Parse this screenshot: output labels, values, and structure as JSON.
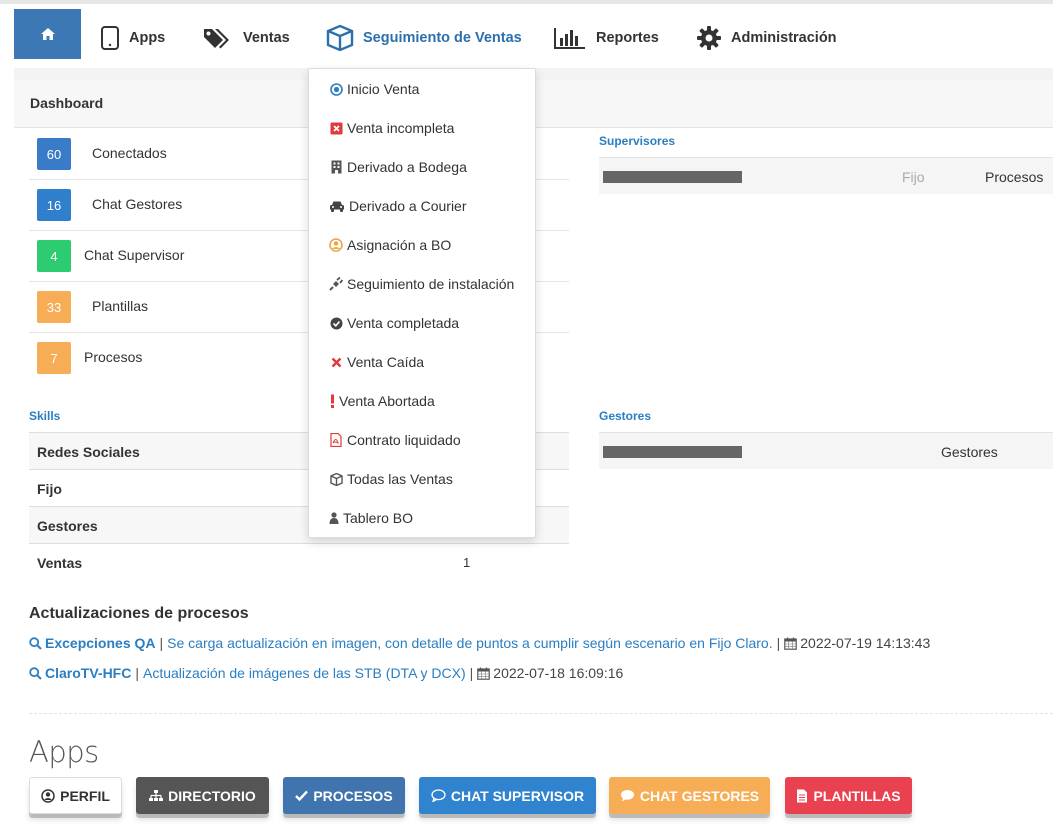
{
  "nav": {
    "items": [
      {
        "label": "Apps",
        "icon": "tablet-icon"
      },
      {
        "label": "Ventas",
        "icon": "tags-icon"
      },
      {
        "label": "Seguimiento de Ventas",
        "icon": "cube-icon"
      },
      {
        "label": "Reportes",
        "icon": "bar-chart-icon"
      },
      {
        "label": "Administración",
        "icon": "gear-icon"
      }
    ],
    "accent": "#3c78b4"
  },
  "dashboard": {
    "title": "Dashboard",
    "counters": [
      {
        "value": "60",
        "label": "Conectados",
        "color": "#3a7bc8"
      },
      {
        "value": "16",
        "label": "Chat Gestores",
        "color": "#2f7fcd"
      },
      {
        "value": "4",
        "label": "Chat Supervisor",
        "color": "#2ecc71"
      },
      {
        "value": "33",
        "label": "Plantillas",
        "color": "#f6ad55"
      },
      {
        "value": "7",
        "label": "Procesos",
        "color": "#f6ad55"
      }
    ],
    "skills_label": "Skills",
    "skills": [
      {
        "name": "Redes Sociales",
        "value": ""
      },
      {
        "name": "Fijo",
        "value": ""
      },
      {
        "name": "Gestores",
        "value": ""
      },
      {
        "name": "Ventas",
        "value": "1"
      }
    ],
    "supervisores": {
      "label": "Supervisores",
      "row": {
        "fijo": "Fijo",
        "procesos": "Procesos"
      }
    },
    "gestores": {
      "label": "Gestores",
      "row": {
        "gestores": "Gestores"
      }
    }
  },
  "dropdown": {
    "items": [
      {
        "label": "Inicio Venta",
        "icon": "target-icon"
      },
      {
        "label": "Venta incompleta",
        "icon": "x-square-icon"
      },
      {
        "label": "Derivado a Bodega",
        "icon": "building-icon"
      },
      {
        "label": "Derivado a Courier",
        "icon": "car-icon"
      },
      {
        "label": "Asignación a BO",
        "icon": "user-circle-icon"
      },
      {
        "label": "Seguimiento de instalación",
        "icon": "plug-icon"
      },
      {
        "label": "Venta completada",
        "icon": "check-circle-icon"
      },
      {
        "label": "Venta Caída",
        "icon": "x-icon"
      },
      {
        "label": "Venta Abortada",
        "icon": "exclamation-icon"
      },
      {
        "label": "Contrato liquidado",
        "icon": "pdf-icon"
      },
      {
        "label": "Todas las Ventas",
        "icon": "cube-icon"
      },
      {
        "label": "Tablero BO",
        "icon": "user-icon"
      }
    ]
  },
  "updates": {
    "title": "Actualizaciones de procesos",
    "items": [
      {
        "name": "Excepciones QA",
        "desc": "Se carga actualización en imagen, con detalle de puntos a cumplir según escenario en Fijo Claro.",
        "date": "2022-07-19 14:13:43"
      },
      {
        "name": "ClaroTV-HFC",
        "desc": "Actualización de imágenes de las STB (DTA y DCX)",
        "date": "2022-07-18 16:09:16"
      }
    ]
  },
  "apps": {
    "heading": "Apps",
    "buttons": [
      {
        "label": "PERFIL",
        "color": "#ffffff",
        "icon": "user-circle-icon"
      },
      {
        "label": "DIRECTORIO",
        "color": "#555555",
        "icon": "sitemap-icon"
      },
      {
        "label": "PROCESOS",
        "color": "#3f74ae",
        "icon": "check-icon"
      },
      {
        "label": "CHAT SUPERVISOR",
        "color": "#2f83cf",
        "icon": "chat-outline-icon"
      },
      {
        "label": "CHAT GESTORES",
        "color": "#f6ad55",
        "icon": "chat-icon"
      },
      {
        "label": "PLANTILLAS",
        "color": "#e9414f",
        "icon": "file-icon"
      }
    ]
  }
}
